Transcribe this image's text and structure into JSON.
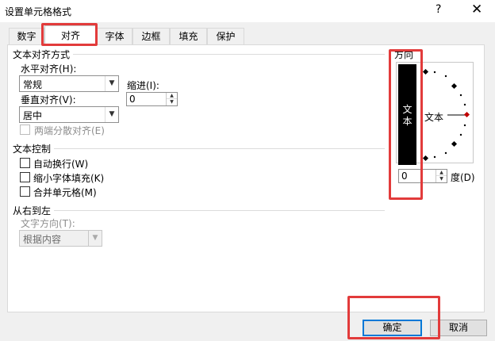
{
  "window": {
    "title": "设置单元格格式",
    "help_label": "?",
    "close_label": "✕"
  },
  "tabs": [
    {
      "label": "数字",
      "active": false
    },
    {
      "label": "对齐",
      "active": true
    },
    {
      "label": "字体",
      "active": false
    },
    {
      "label": "边框",
      "active": false
    },
    {
      "label": "填充",
      "active": false
    },
    {
      "label": "保护",
      "active": false
    }
  ],
  "alignment": {
    "section_title": "文本对齐方式",
    "horizontal_label": "水平对齐(H):",
    "horizontal_value": "常规",
    "indent_label": "缩进(I):",
    "indent_value": "0",
    "vertical_label": "垂直对齐(V):",
    "vertical_value": "居中",
    "justify_distributed_label": "两端分散对齐(E)"
  },
  "text_control": {
    "section_title": "文本控制",
    "wrap_text_label": "自动换行(W)",
    "shrink_to_fit_label": "缩小字体填充(K)",
    "merge_cells_label": "合并单元格(M)"
  },
  "rtl": {
    "section_title": "从右到左",
    "direction_label": "文字方向(T):",
    "direction_value": "根据内容"
  },
  "orientation": {
    "section_title": "方向",
    "vertical_text": "文本",
    "dial_text": "文本",
    "degrees_value": "0",
    "degrees_label": "度(D)"
  },
  "buttons": {
    "ok_label": "确定",
    "cancel_label": "取消"
  },
  "colors": {
    "highlight": "#e23b3b",
    "default_button_border": "#0078d7",
    "dial_active_marker": "#c00000"
  },
  "icons": {
    "dropdown": "chevron-down-icon",
    "spin_up": "triangle-up-icon",
    "spin_down": "triangle-down-icon"
  }
}
